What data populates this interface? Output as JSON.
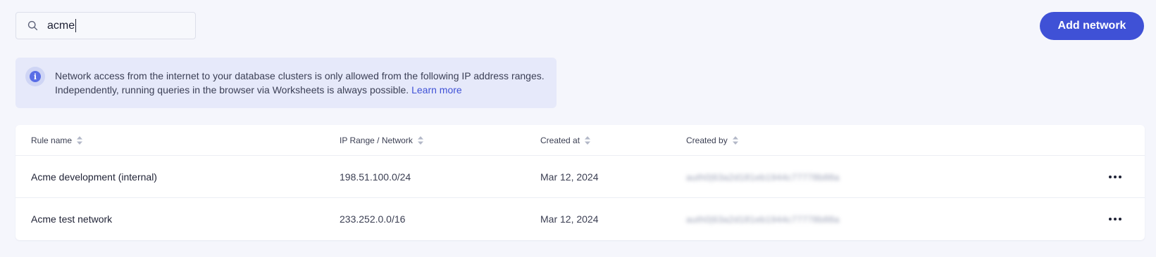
{
  "search": {
    "value": "acme"
  },
  "header": {
    "add_button_label": "Add network"
  },
  "banner": {
    "text": "Network access from the internet to your database clusters is only allowed from the following IP address ranges. Independently, running queries in the browser via Worksheets is always possible.",
    "link_label": "Learn more"
  },
  "table": {
    "columns": [
      "Rule name",
      "IP Range / Network",
      "Created at",
      "Created by"
    ],
    "rows": [
      {
        "rule_name": "Acme development (internal)",
        "ip_range": "198.51.100.0/24",
        "created_at": "Mar 12, 2024",
        "created_by": "auth0|63a2d181eb1944c77778b88a"
      },
      {
        "rule_name": "Acme test network",
        "ip_range": "233.252.0.0/16",
        "created_at": "Mar 12, 2024",
        "created_by": "auth0|63a2d181eb1944c77778b88a"
      }
    ]
  },
  "colors": {
    "accent": "#3f51d6",
    "background": "#f5f6fc",
    "banner_bg": "#e6e9fa"
  }
}
